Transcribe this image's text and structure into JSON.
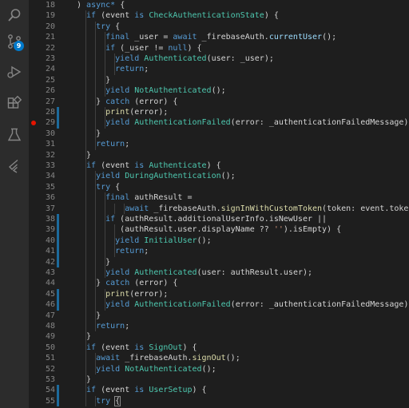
{
  "activity_bar": {
    "items": [
      {
        "name": "explorer-icon",
        "label": "Explorer"
      },
      {
        "name": "source-control-icon",
        "label": "Source Control",
        "badge": "9"
      },
      {
        "name": "run-debug-icon",
        "label": "Run and Debug"
      },
      {
        "name": "extensions-icon",
        "label": "Extensions"
      },
      {
        "name": "testing-icon",
        "label": "Testing"
      },
      {
        "name": "flutter-icon",
        "label": "Flutter"
      }
    ],
    "badge_color": "#007acc"
  },
  "editor": {
    "breakpoint_line": 29,
    "modified_gutter_lines": [
      28,
      29,
      38,
      39,
      40,
      41,
      42,
      45,
      46,
      54,
      55
    ],
    "lines": [
      {
        "n": 18,
        "indent": 0,
        "tokens": [
          [
            "pl",
            ") "
          ],
          [
            "kw",
            "async*"
          ],
          [
            "pl",
            " {"
          ]
        ]
      },
      {
        "n": 19,
        "indent": 1,
        "tokens": [
          [
            "kw",
            "if"
          ],
          [
            "pl",
            " (event "
          ],
          [
            "kw",
            "is"
          ],
          [
            "pl",
            " "
          ],
          [
            "ty",
            "CheckAuthenticationState"
          ],
          [
            "pl",
            ") {"
          ]
        ]
      },
      {
        "n": 20,
        "indent": 2,
        "tokens": [
          [
            "kw",
            "try"
          ],
          [
            "pl",
            " {"
          ]
        ]
      },
      {
        "n": 21,
        "indent": 3,
        "tokens": [
          [
            "kw",
            "final"
          ],
          [
            "pl",
            " _user = "
          ],
          [
            "kw",
            "await"
          ],
          [
            "pl",
            " _firebaseAuth."
          ],
          [
            "vr",
            "currentUser"
          ],
          [
            "pl",
            "();"
          ]
        ]
      },
      {
        "n": 22,
        "indent": 3,
        "tokens": [
          [
            "kw",
            "if"
          ],
          [
            "pl",
            " (_user != "
          ],
          [
            "kw",
            "null"
          ],
          [
            "pl",
            ") {"
          ]
        ]
      },
      {
        "n": 23,
        "indent": 4,
        "tokens": [
          [
            "kw",
            "yield"
          ],
          [
            "pl",
            " "
          ],
          [
            "ty",
            "Authenticated"
          ],
          [
            "pl",
            "(user: _user);"
          ]
        ]
      },
      {
        "n": 24,
        "indent": 4,
        "tokens": [
          [
            "kw",
            "return"
          ],
          [
            "pl",
            ";"
          ]
        ]
      },
      {
        "n": 25,
        "indent": 3,
        "tokens": [
          [
            "pl",
            "}"
          ]
        ]
      },
      {
        "n": 26,
        "indent": 3,
        "tokens": [
          [
            "kw",
            "yield"
          ],
          [
            "pl",
            " "
          ],
          [
            "ty",
            "NotAuthenticated"
          ],
          [
            "pl",
            "();"
          ]
        ]
      },
      {
        "n": 27,
        "indent": 2,
        "tokens": [
          [
            "pl",
            "} "
          ],
          [
            "kw",
            "catch"
          ],
          [
            "pl",
            " (error) {"
          ]
        ]
      },
      {
        "n": 28,
        "indent": 3,
        "tokens": [
          [
            "fn",
            "print"
          ],
          [
            "pl",
            "(error);"
          ]
        ]
      },
      {
        "n": 29,
        "indent": 3,
        "tokens": [
          [
            "kw",
            "yield"
          ],
          [
            "pl",
            " "
          ],
          [
            "ty",
            "AuthenticationFailed"
          ],
          [
            "pl",
            "(error: _authenticationFailedMessage);"
          ]
        ]
      },
      {
        "n": 30,
        "indent": 2,
        "tokens": [
          [
            "pl",
            "}"
          ]
        ]
      },
      {
        "n": 31,
        "indent": 2,
        "tokens": [
          [
            "kw",
            "return"
          ],
          [
            "pl",
            ";"
          ]
        ]
      },
      {
        "n": 32,
        "indent": 1,
        "tokens": [
          [
            "pl",
            "}"
          ]
        ]
      },
      {
        "n": 33,
        "indent": 1,
        "tokens": [
          [
            "kw",
            "if"
          ],
          [
            "pl",
            " (event "
          ],
          [
            "kw",
            "is"
          ],
          [
            "pl",
            " "
          ],
          [
            "ty",
            "Authenticate"
          ],
          [
            "pl",
            ") {"
          ]
        ]
      },
      {
        "n": 34,
        "indent": 2,
        "tokens": [
          [
            "kw",
            "yield"
          ],
          [
            "pl",
            " "
          ],
          [
            "ty",
            "DuringAuthentication"
          ],
          [
            "pl",
            "();"
          ]
        ]
      },
      {
        "n": 35,
        "indent": 2,
        "tokens": [
          [
            "kw",
            "try"
          ],
          [
            "pl",
            " {"
          ]
        ]
      },
      {
        "n": 36,
        "indent": 3,
        "tokens": [
          [
            "kw",
            "final"
          ],
          [
            "pl",
            " authResult ="
          ]
        ]
      },
      {
        "n": 37,
        "indent": 5,
        "tokens": [
          [
            "kw",
            "await"
          ],
          [
            "pl",
            " _firebaseAuth."
          ],
          [
            "fn",
            "signInWithCustomToken"
          ],
          [
            "pl",
            "(token: event.token);"
          ]
        ]
      },
      {
        "n": 38,
        "indent": 3,
        "tokens": [
          [
            "kw",
            "if"
          ],
          [
            "pl",
            " (authResult.additionalUserInfo.isNewUser ||"
          ]
        ]
      },
      {
        "n": 39,
        "indent": 4,
        "extra": 1,
        "tokens": [
          [
            "pl",
            "(authResult.user.displayName ?? "
          ],
          [
            "st",
            "''"
          ],
          [
            "pl",
            ").isEmpty) {"
          ]
        ]
      },
      {
        "n": 40,
        "indent": 4,
        "tokens": [
          [
            "kw",
            "yield"
          ],
          [
            "pl",
            " "
          ],
          [
            "ty",
            "InitialUser"
          ],
          [
            "pl",
            "();"
          ]
        ]
      },
      {
        "n": 41,
        "indent": 4,
        "tokens": [
          [
            "kw",
            "return"
          ],
          [
            "pl",
            ";"
          ]
        ]
      },
      {
        "n": 42,
        "indent": 3,
        "tokens": [
          [
            "pl",
            "}"
          ]
        ]
      },
      {
        "n": 43,
        "indent": 3,
        "tokens": [
          [
            "kw",
            "yield"
          ],
          [
            "pl",
            " "
          ],
          [
            "ty",
            "Authenticated"
          ],
          [
            "pl",
            "(user: authResult.user);"
          ]
        ]
      },
      {
        "n": 44,
        "indent": 2,
        "tokens": [
          [
            "pl",
            "} "
          ],
          [
            "kw",
            "catch"
          ],
          [
            "pl",
            " (error) {"
          ]
        ]
      },
      {
        "n": 45,
        "indent": 3,
        "tokens": [
          [
            "fn",
            "print"
          ],
          [
            "pl",
            "(error);"
          ]
        ]
      },
      {
        "n": 46,
        "indent": 3,
        "tokens": [
          [
            "kw",
            "yield"
          ],
          [
            "pl",
            " "
          ],
          [
            "ty",
            "AuthenticationFailed"
          ],
          [
            "pl",
            "(error: _authenticationFailedMessage);"
          ]
        ]
      },
      {
        "n": 47,
        "indent": 2,
        "tokens": [
          [
            "pl",
            "}"
          ]
        ]
      },
      {
        "n": 48,
        "indent": 2,
        "tokens": [
          [
            "kw",
            "return"
          ],
          [
            "pl",
            ";"
          ]
        ]
      },
      {
        "n": 49,
        "indent": 1,
        "tokens": [
          [
            "pl",
            "}"
          ]
        ]
      },
      {
        "n": 50,
        "indent": 1,
        "tokens": [
          [
            "kw",
            "if"
          ],
          [
            "pl",
            " (event "
          ],
          [
            "kw",
            "is"
          ],
          [
            "pl",
            " "
          ],
          [
            "ty",
            "SignOut"
          ],
          [
            "pl",
            ") {"
          ]
        ]
      },
      {
        "n": 51,
        "indent": 2,
        "tokens": [
          [
            "kw",
            "await"
          ],
          [
            "pl",
            " _firebaseAuth."
          ],
          [
            "fn",
            "signOut"
          ],
          [
            "pl",
            "();"
          ]
        ]
      },
      {
        "n": 52,
        "indent": 2,
        "tokens": [
          [
            "kw",
            "yield"
          ],
          [
            "pl",
            " "
          ],
          [
            "ty",
            "NotAuthenticated"
          ],
          [
            "pl",
            "();"
          ]
        ]
      },
      {
        "n": 53,
        "indent": 1,
        "tokens": [
          [
            "pl",
            "}"
          ]
        ]
      },
      {
        "n": 54,
        "indent": 1,
        "tokens": [
          [
            "kw",
            "if"
          ],
          [
            "pl",
            " (event "
          ],
          [
            "kw",
            "is"
          ],
          [
            "pl",
            " "
          ],
          [
            "ty",
            "UserSetup"
          ],
          [
            "pl",
            ") {"
          ]
        ]
      },
      {
        "n": 55,
        "indent": 2,
        "tokens": [
          [
            "kw",
            "try"
          ],
          [
            "pl",
            " "
          ],
          [
            "bracket",
            "{"
          ]
        ]
      }
    ]
  }
}
